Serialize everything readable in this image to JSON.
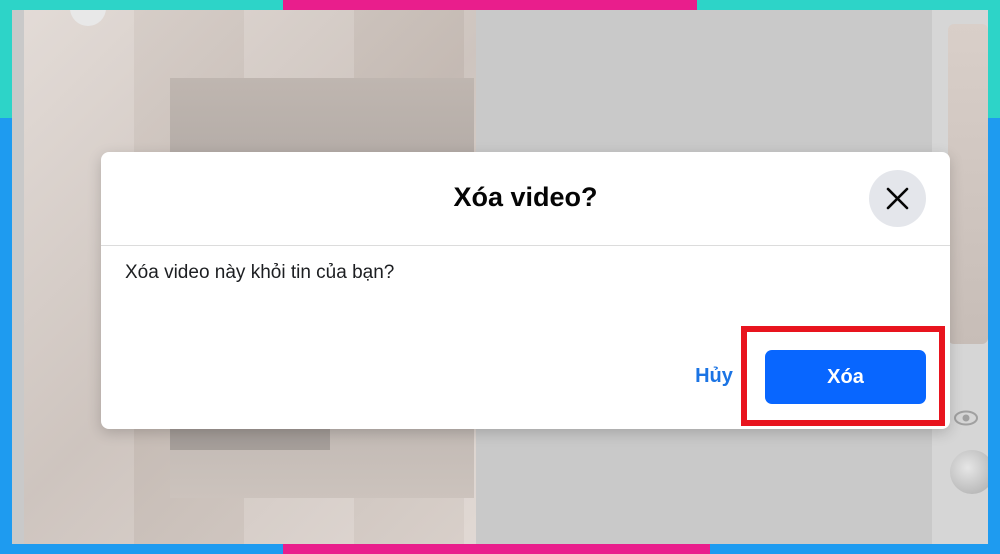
{
  "dialog": {
    "title": "Xóa video?",
    "message": "Xóa video này khỏi tin của bạn?",
    "cancel_label": "Hủy",
    "delete_label": "Xóa",
    "close_icon": "close-icon"
  },
  "colors": {
    "primary_button": "#0866ff",
    "link": "#1b74e4",
    "highlight": "#e8141e"
  }
}
